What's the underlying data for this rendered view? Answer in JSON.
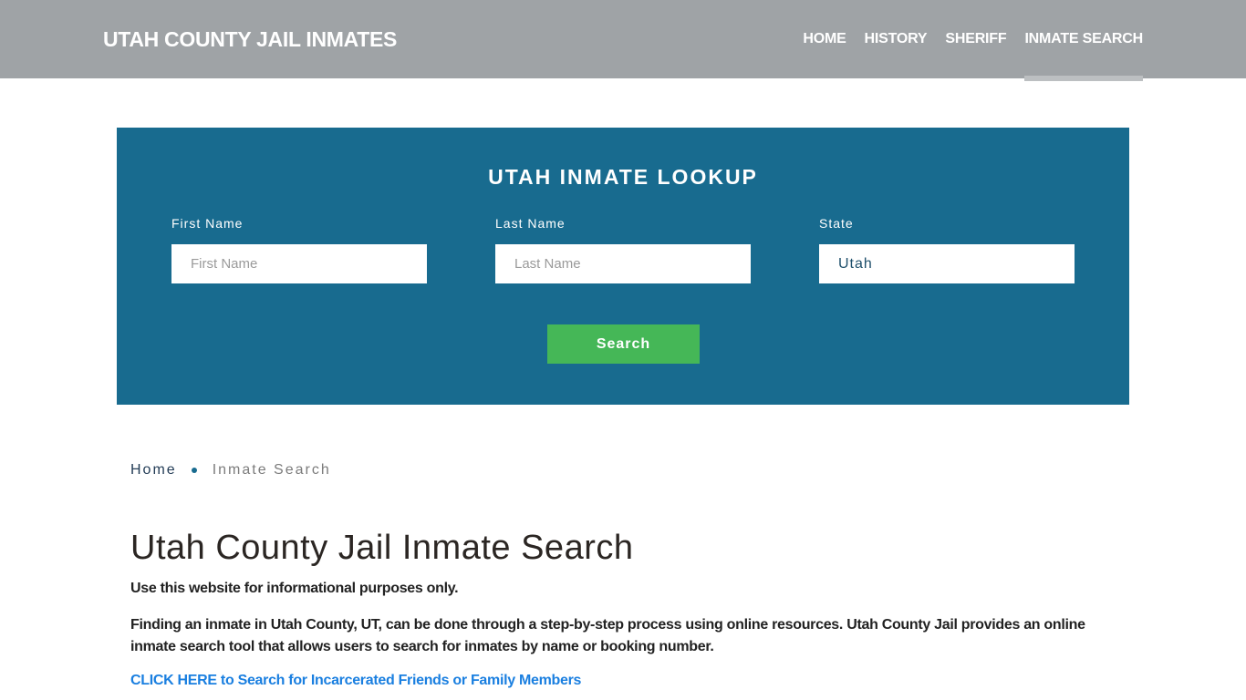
{
  "header": {
    "brand": "UTAH COUNTY JAIL INMATES",
    "nav": [
      {
        "label": "HOME",
        "active": false
      },
      {
        "label": "HISTORY",
        "active": false
      },
      {
        "label": "SHERIFF",
        "active": false
      },
      {
        "label": "INMATE SEARCH",
        "active": true
      }
    ]
  },
  "lookup": {
    "title": "UTAH INMATE LOOKUP",
    "fields": [
      {
        "label": "First Name",
        "placeholder": "First Name",
        "value": ""
      },
      {
        "label": "Last Name",
        "placeholder": "Last Name",
        "value": ""
      },
      {
        "label": "State",
        "placeholder": "",
        "value": "Utah"
      }
    ],
    "button": "Search",
    "colors": {
      "panel": "#186b8f",
      "button": "#45b757"
    }
  },
  "breadcrumb": {
    "home": "Home",
    "current": "Inmate Search"
  },
  "content": {
    "title": "Utah County Jail Inmate Search",
    "disclaimer": "Use this website for informational purposes only.",
    "intro": "Finding an inmate in Utah County, UT, can be done through a step-by-step process using online resources. Utah County Jail provides an online inmate search tool that allows users to search for inmates by name or booking number.",
    "cta": "CLICK HERE to Search for Incarcerated Friends or Family Members"
  }
}
